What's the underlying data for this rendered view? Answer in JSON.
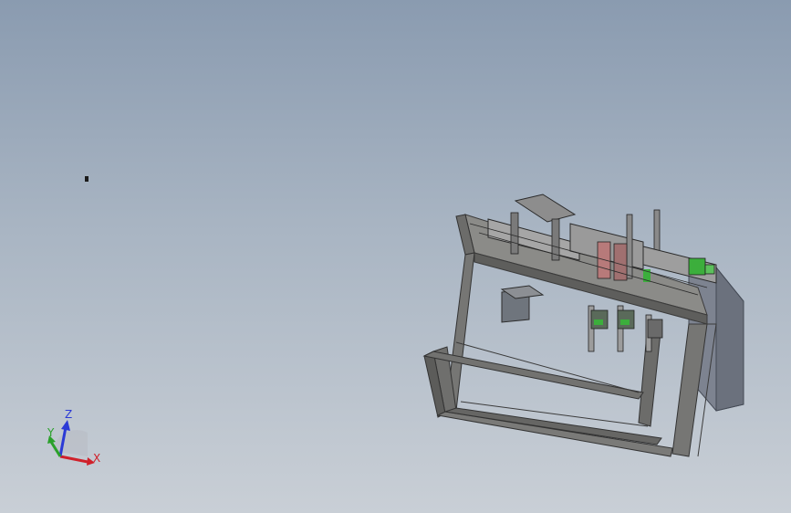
{
  "viewport": {
    "background_top": "#8a9bb0",
    "background_bottom": "#c9cfd6"
  },
  "model": {
    "frame_color": "#6e6e6e",
    "cabinet_color": "#7d8390",
    "accent_green": "#3cae3c",
    "accent_pink": "#b77a7a"
  },
  "triad": {
    "x_label": "X",
    "y_label": "Y",
    "z_label": "Z",
    "x_color": "#d0202a",
    "y_color": "#2aa02a",
    "z_color": "#2b3ad6"
  }
}
